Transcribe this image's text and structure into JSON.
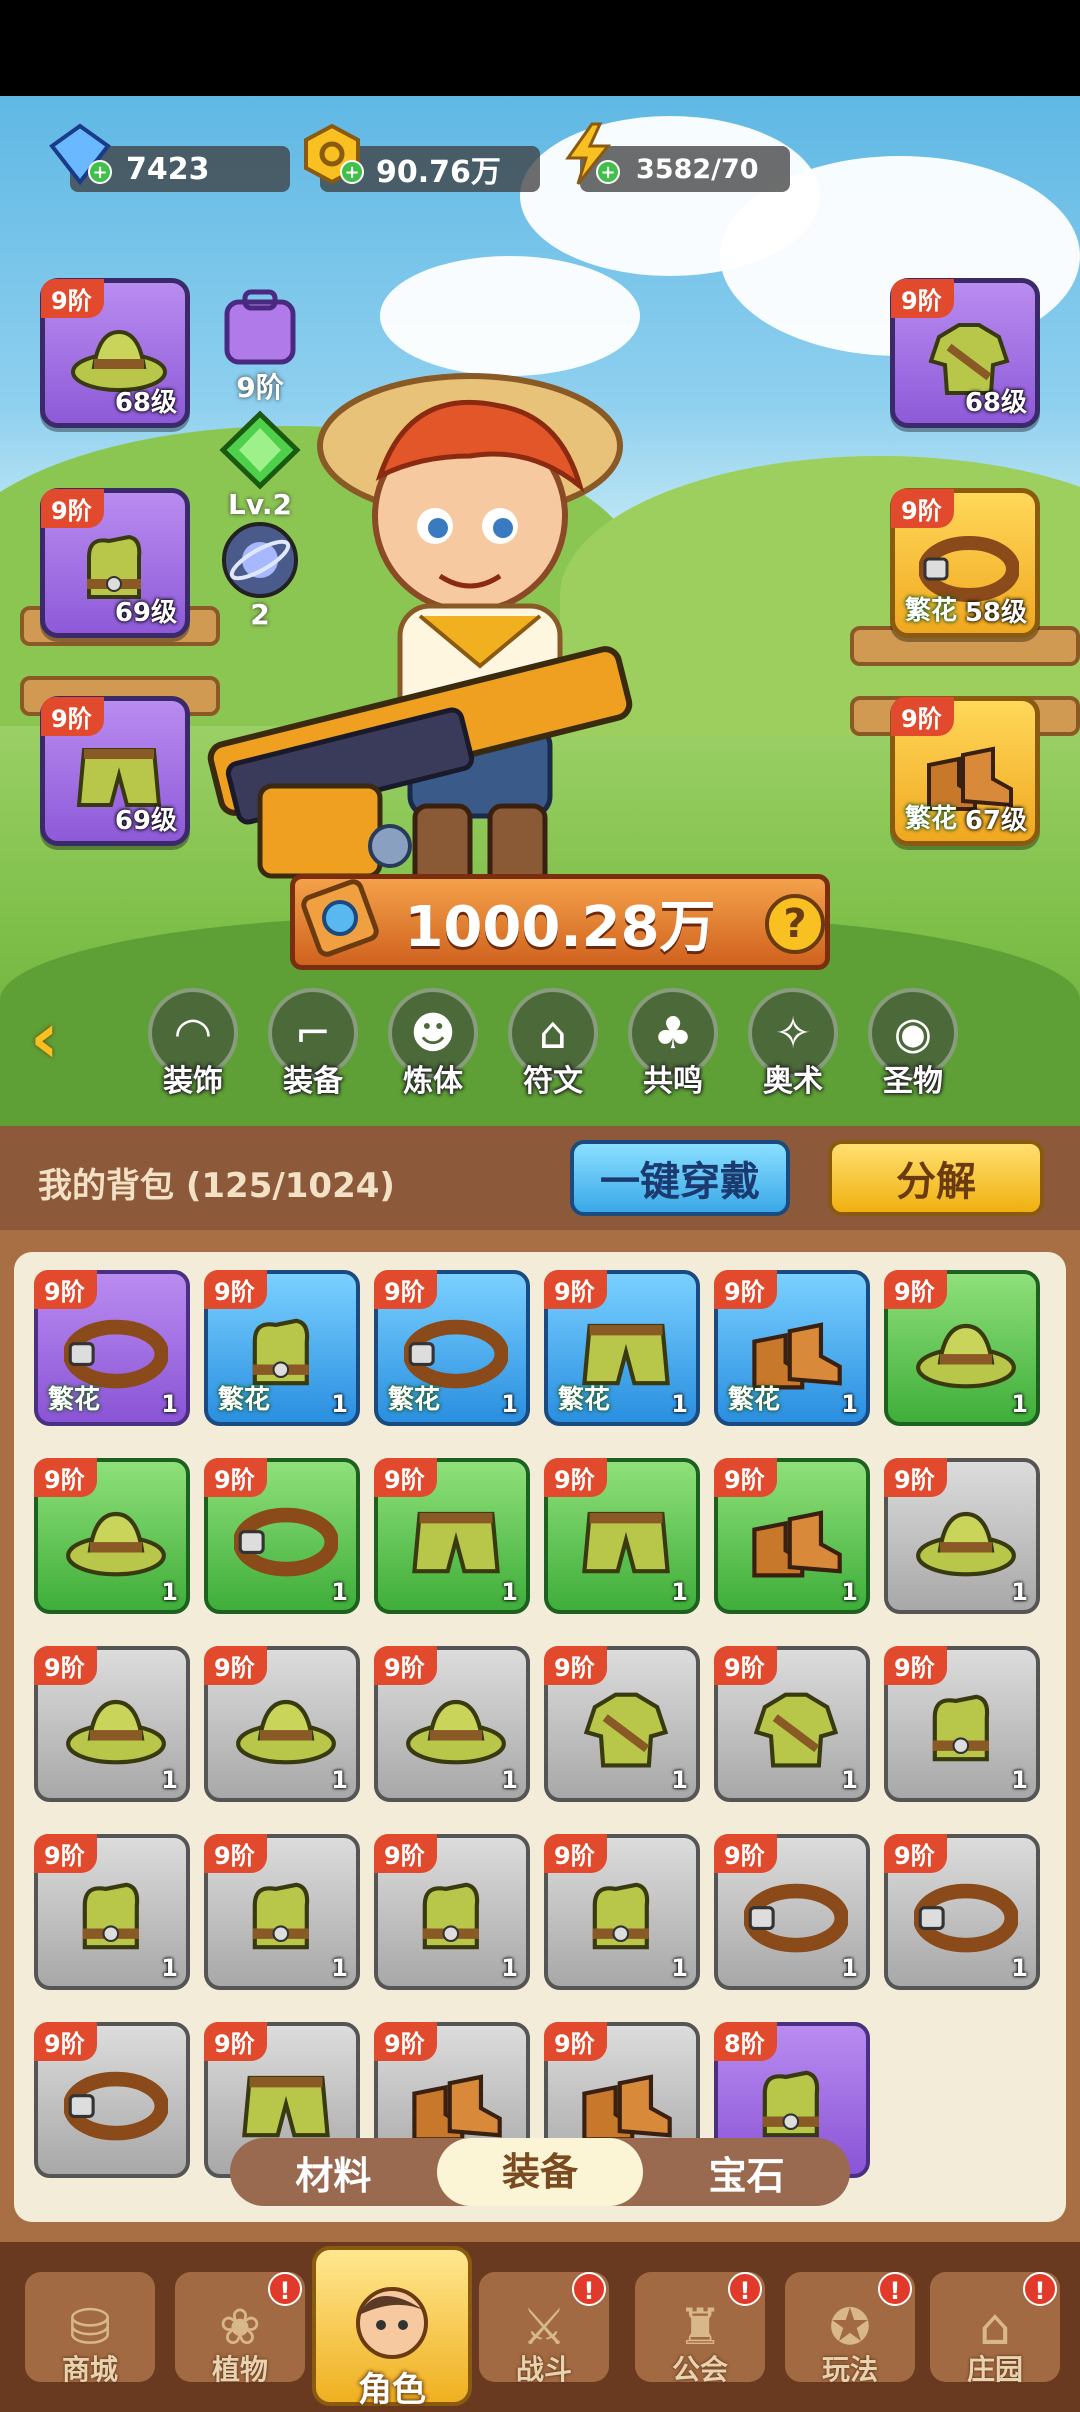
{
  "currency": {
    "gems": "7423",
    "gold": "90.76万",
    "energy": "3582/70"
  },
  "equipped_left": [
    {
      "tier": "9阶",
      "level": "68级",
      "icon": "hat-icon"
    },
    {
      "tier": "9阶",
      "level": "69级",
      "icon": "gloves-icon"
    },
    {
      "tier": "9阶",
      "level": "69级",
      "icon": "shorts-icon"
    }
  ],
  "equipped_right": [
    {
      "tier": "9阶",
      "level": "68级",
      "icon": "shirt-icon",
      "fanhua": ""
    },
    {
      "tier": "9阶",
      "level": "58级",
      "icon": "belt-icon",
      "fanhua": "繁花"
    },
    {
      "tier": "9阶",
      "level": "67级",
      "icon": "boots-icon",
      "fanhua": "繁花"
    }
  ],
  "center_stats": {
    "bag_tier": "9阶",
    "gem_level": "Lv.2",
    "orb_count": "2"
  },
  "power": "1000.28万",
  "categories": [
    "装饰",
    "装备",
    "炼体",
    "符文",
    "共鸣",
    "奥术",
    "圣物"
  ],
  "bag": {
    "title": "我的背包 (125/1024)",
    "equip_all": "一键穿戴",
    "decompose": "分解"
  },
  "bag_items": [
    {
      "tier": "9阶",
      "rarity": "purple",
      "icon": "belt-icon",
      "fanhua": "繁花",
      "count": "1"
    },
    {
      "tier": "9阶",
      "rarity": "blue",
      "icon": "gloves-icon",
      "fanhua": "繁花",
      "count": "1"
    },
    {
      "tier": "9阶",
      "rarity": "blue",
      "icon": "belt-icon",
      "fanhua": "繁花",
      "count": "1"
    },
    {
      "tier": "9阶",
      "rarity": "blue",
      "icon": "shorts-icon",
      "fanhua": "繁花",
      "count": "1"
    },
    {
      "tier": "9阶",
      "rarity": "blue",
      "icon": "boots-icon",
      "fanhua": "繁花",
      "count": "1"
    },
    {
      "tier": "9阶",
      "rarity": "green",
      "icon": "hat-icon",
      "fanhua": "",
      "count": "1"
    },
    {
      "tier": "9阶",
      "rarity": "green",
      "icon": "hat-icon",
      "fanhua": "",
      "count": "1"
    },
    {
      "tier": "9阶",
      "rarity": "green",
      "icon": "belt-icon",
      "fanhua": "",
      "count": "1"
    },
    {
      "tier": "9阶",
      "rarity": "green",
      "icon": "shorts-icon",
      "fanhua": "",
      "count": "1"
    },
    {
      "tier": "9阶",
      "rarity": "green",
      "icon": "shorts-icon",
      "fanhua": "",
      "count": "1"
    },
    {
      "tier": "9阶",
      "rarity": "green",
      "icon": "boots-icon",
      "fanhua": "",
      "count": "1"
    },
    {
      "tier": "9阶",
      "rarity": "grey",
      "icon": "hat-icon",
      "fanhua": "",
      "count": "1"
    },
    {
      "tier": "9阶",
      "rarity": "grey",
      "icon": "hat-icon",
      "fanhua": "",
      "count": "1"
    },
    {
      "tier": "9阶",
      "rarity": "grey",
      "icon": "hat-icon",
      "fanhua": "",
      "count": "1"
    },
    {
      "tier": "9阶",
      "rarity": "grey",
      "icon": "hat-icon",
      "fanhua": "",
      "count": "1"
    },
    {
      "tier": "9阶",
      "rarity": "grey",
      "icon": "shirt-icon",
      "fanhua": "",
      "count": "1"
    },
    {
      "tier": "9阶",
      "rarity": "grey",
      "icon": "shirt-icon",
      "fanhua": "",
      "count": "1"
    },
    {
      "tier": "9阶",
      "rarity": "grey",
      "icon": "gloves-icon",
      "fanhua": "",
      "count": "1"
    },
    {
      "tier": "9阶",
      "rarity": "grey",
      "icon": "gloves-icon",
      "fanhua": "",
      "count": "1"
    },
    {
      "tier": "9阶",
      "rarity": "grey",
      "icon": "gloves-icon",
      "fanhua": "",
      "count": "1"
    },
    {
      "tier": "9阶",
      "rarity": "grey",
      "icon": "gloves-icon",
      "fanhua": "",
      "count": "1"
    },
    {
      "tier": "9阶",
      "rarity": "grey",
      "icon": "gloves-icon",
      "fanhua": "",
      "count": "1"
    },
    {
      "tier": "9阶",
      "rarity": "grey",
      "icon": "belt-icon",
      "fanhua": "",
      "count": "1"
    },
    {
      "tier": "9阶",
      "rarity": "grey",
      "icon": "belt-icon",
      "fanhua": "",
      "count": "1"
    },
    {
      "tier": "9阶",
      "rarity": "grey",
      "icon": "belt-icon",
      "fanhua": "",
      "count": ""
    },
    {
      "tier": "9阶",
      "rarity": "grey",
      "icon": "shorts-icon",
      "fanhua": "",
      "count": ""
    },
    {
      "tier": "9阶",
      "rarity": "grey",
      "icon": "boots-icon",
      "fanhua": "",
      "count": ""
    },
    {
      "tier": "9阶",
      "rarity": "grey",
      "icon": "boots-icon",
      "fanhua": "",
      "count": ""
    },
    {
      "tier": "8阶",
      "rarity": "purple",
      "icon": "gloves-icon",
      "fanhua": "",
      "count": ""
    }
  ],
  "tabs": [
    "材料",
    "装备",
    "宝石"
  ],
  "active_tab": "装备",
  "nav": [
    {
      "label": "商城",
      "badge": false,
      "active": false
    },
    {
      "label": "植物",
      "badge": true,
      "active": false
    },
    {
      "label": "角色",
      "badge": false,
      "active": true
    },
    {
      "label": "战斗",
      "badge": true,
      "active": false
    },
    {
      "label": "公会",
      "badge": true,
      "active": false
    },
    {
      "label": "玩法",
      "badge": true,
      "active": false
    },
    {
      "label": "庄园",
      "badge": true,
      "active": false
    }
  ],
  "colors": {
    "tier_badge": "#e24a2e",
    "equip_all_button": "#4cc0f0",
    "decompose_button": "#f8c020",
    "panel_brown": "#a86e44"
  }
}
